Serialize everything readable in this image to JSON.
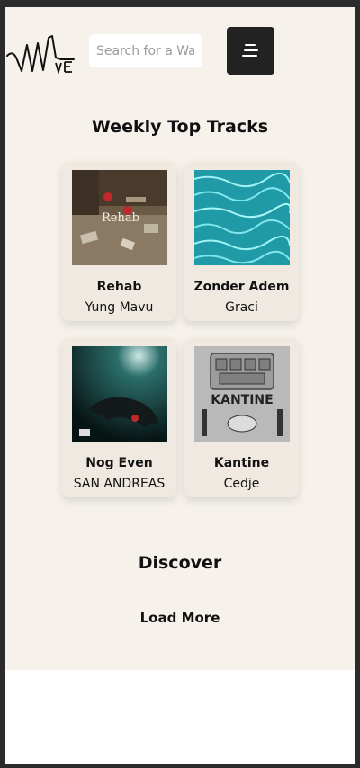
{
  "header": {
    "logo_text": "WAVE",
    "search_placeholder": "Search for a Wave",
    "menu_icon": "hamburger-menu-icon"
  },
  "weekly": {
    "title": "Weekly Top Tracks",
    "tracks": [
      {
        "title": "Rehab",
        "artist": "Yung Mavu",
        "cover_text": "Rehab"
      },
      {
        "title": "Zonder Adem",
        "artist": "Graci"
      },
      {
        "title": "Nog Even",
        "artist": "SAN ANDREAS"
      },
      {
        "title": "Kantine",
        "artist": "Cedje",
        "cover_text": "KANTINE"
      }
    ]
  },
  "discover": {
    "title": "Discover",
    "load_more_label": "Load More"
  },
  "colors": {
    "background": "#f6f1eb",
    "card": "#efe9e2",
    "menu_button": "#222222",
    "text": "#111111"
  }
}
